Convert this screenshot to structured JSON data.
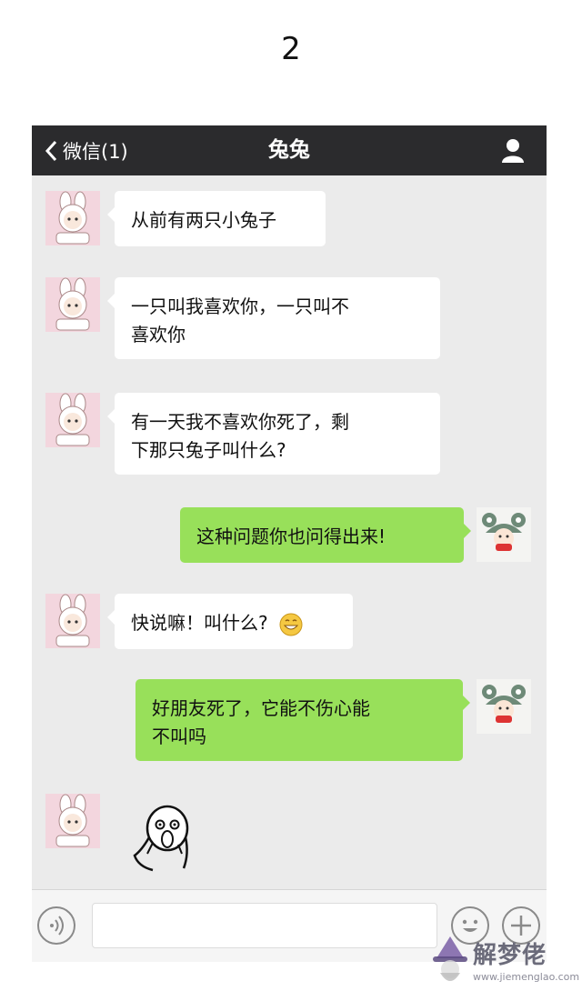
{
  "page_number": "2",
  "navbar": {
    "back_label": "微信(1)",
    "title": "兔兔"
  },
  "messages": [
    {
      "from": "them",
      "text": "从前有两只小兔子"
    },
    {
      "from": "them",
      "text": "一只叫我喜欢你，一只叫不喜欢你",
      "line1": "一只叫我喜欢你，一只叫不",
      "line2": "喜欢你"
    },
    {
      "from": "them",
      "text": "有一天我不喜欢你死了，剩下那只兔子叫什么?",
      "line1": "有一天我不喜欢你死了，剩",
      "line2": "下那只兔子叫什么?"
    },
    {
      "from": "me",
      "text": "这种问题你也问得出来!"
    },
    {
      "from": "them",
      "text": "快说嘛！叫什么?",
      "emoji": "grinning-sweat-emoji"
    },
    {
      "from": "me",
      "text": "好朋友死了，它能不伤心能不叫吗",
      "line1": "好朋友死了，它能不伤心能",
      "line2": "不叫吗"
    },
    {
      "from": "them",
      "sticker": "shocked-face-sticker"
    }
  ],
  "input": {
    "placeholder": ""
  },
  "watermark": {
    "text": "解梦佬",
    "url": "www.jiemenglao.com"
  },
  "colors": {
    "navbar": "#2b2b2d",
    "chat_bg": "#ebebeb",
    "incoming_bubble": "#ffffff",
    "outgoing_bubble": "#98e05a"
  }
}
